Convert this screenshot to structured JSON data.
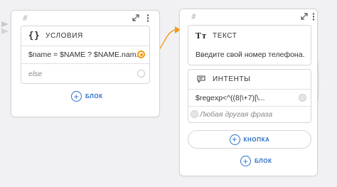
{
  "conditions_node": {
    "hash": "#",
    "section_title": "УСЛОВИЯ",
    "rows": [
      {
        "text": "$name = $NAME ? $NAME.nam..."
      },
      {
        "text": "else"
      }
    ],
    "add_block_label": "БЛОК"
  },
  "text_node": {
    "hash": "#",
    "text_section_title": "ТЕКСТ",
    "text_value": "Введите свой номер телефона.",
    "intents_section_title": "ИНТЕНТЫ",
    "intent_rows": [
      {
        "text": "$regexp<^((8|\\+7)[\\..."
      },
      {
        "text": "Любая другая фраза"
      }
    ],
    "add_button_label": "КНОПКА",
    "add_block_label": "БЛОК"
  },
  "icons": {
    "expand": "expand-icon",
    "menu": "more-vertical-icon",
    "braces": "braces-icon",
    "text_type": "text-type-icon",
    "intents": "chat-bubble-icon",
    "plus": "plus-circle-icon"
  },
  "colors": {
    "accent_orange": "#f29a1a",
    "link_blue": "#2a6fc9",
    "canvas": "#f1f1f3"
  }
}
